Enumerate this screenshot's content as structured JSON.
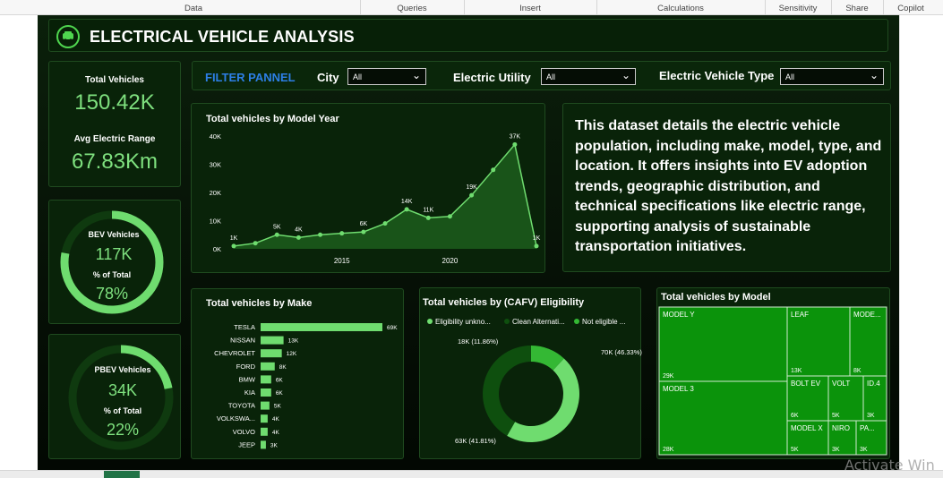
{
  "ribbon": {
    "tabs": [
      "Data",
      "Queries",
      "Insert",
      "Calculations",
      "Sensitivity",
      "Share",
      "Copilot"
    ]
  },
  "dashboard": {
    "title": "ELECTRICAL VEHICLE ANALYSIS"
  },
  "kpis": {
    "total_vehicles_label": "Total Vehicles",
    "total_vehicles_value": "150.42K",
    "avg_range_label": "Avg Electric Range",
    "avg_range_value": "67.83Km"
  },
  "bev": {
    "label": "BEV Vehicles",
    "value": "117K",
    "pct_label": "% of Total",
    "pct_value": "78%",
    "fraction": 0.78
  },
  "pbev": {
    "label": "PBEV Vehicles",
    "value": "34K",
    "pct_label": "% of Total",
    "pct_value": "22%",
    "fraction": 0.22
  },
  "filter": {
    "title": "FILTER PANNEL",
    "city_label": "City",
    "city_value": "All",
    "utility_label": "Electric Utility",
    "utility_value": "All",
    "type_label": "Electric Vehicle Type",
    "type_value": "All"
  },
  "description": "This dataset details the electric vehicle population, including make, model, type, and location. It offers insights into EV adoption trends, geographic distribution, and technical specifications like electric range, supporting analysis of sustainable transportation initiatives.",
  "colors": {
    "accent": "#4fd54f",
    "panel_bg": "#092309",
    "canvas_bg": "#061006",
    "filter_title": "#2d7fe6"
  },
  "chart_data": [
    {
      "type": "area",
      "title": "Total vehicles by Model Year",
      "ylim": [
        0,
        40000
      ],
      "yticks": [
        "0K",
        "10K",
        "20K",
        "30K",
        "40K"
      ],
      "xticks": [
        "2015",
        "2020"
      ],
      "x": [
        2010,
        2011,
        2012,
        2013,
        2014,
        2015,
        2016,
        2017,
        2018,
        2019,
        2020,
        2021,
        2022,
        2023,
        2024
      ],
      "values": [
        1000,
        2000,
        5000,
        4000,
        5000,
        5500,
        6000,
        9000,
        14000,
        11000,
        11500,
        19000,
        28000,
        37000,
        1000
      ],
      "labels": [
        {
          "i": 0,
          "text": "1K"
        },
        {
          "i": 2,
          "text": "5K"
        },
        {
          "i": 3,
          "text": "4K"
        },
        {
          "i": 6,
          "text": "6K"
        },
        {
          "i": 8,
          "text": "14K"
        },
        {
          "i": 9,
          "text": "11K"
        },
        {
          "i": 11,
          "text": "19K"
        },
        {
          "i": 13,
          "text": "37K"
        },
        {
          "i": 14,
          "text": "1K"
        }
      ]
    },
    {
      "type": "bar",
      "title": "Total vehicles by Make",
      "categories": [
        "TESLA",
        "NISSAN",
        "CHEVROLET",
        "FORD",
        "BMW",
        "KIA",
        "TOYOTA",
        "VOLKSWA...",
        "VOLVO",
        "JEEP"
      ],
      "values": [
        69,
        13,
        12,
        8,
        6,
        6,
        5,
        4,
        4,
        3
      ],
      "labels": [
        "69K",
        "13K",
        "12K",
        "8K",
        "6K",
        "6K",
        "5K",
        "4K",
        "4K",
        "3K"
      ]
    },
    {
      "type": "pie",
      "title": "Total vehicles by (CAFV) Eligibility",
      "legend": [
        "Eligibility unkno...",
        "Clean Alternati...",
        "Not eligible ..."
      ],
      "values": [
        70,
        63,
        18
      ],
      "colors": [
        "#6fdc6f",
        "#0e4f0e",
        "#34b834"
      ],
      "labels": [
        "70K (46.33%)",
        "63K (41.81%)",
        "18K (11.86%)"
      ]
    },
    {
      "type": "treemap",
      "title": "Total vehicles by Model",
      "categories": [
        "MODEL Y",
        "MODEL 3",
        "LEAF",
        "MODE...",
        "BOLT EV",
        "VOLT",
        "ID.4",
        "MODEL X",
        "NIRO",
        "PA..."
      ],
      "values": [
        29,
        28,
        13,
        8,
        6,
        5,
        3,
        5,
        3,
        3
      ],
      "labels": [
        "29K",
        "28K",
        "13K",
        "8K",
        "6K",
        "5K",
        "3K",
        "5K",
        "3K",
        "3K"
      ]
    }
  ],
  "watermark": "Activate Win"
}
